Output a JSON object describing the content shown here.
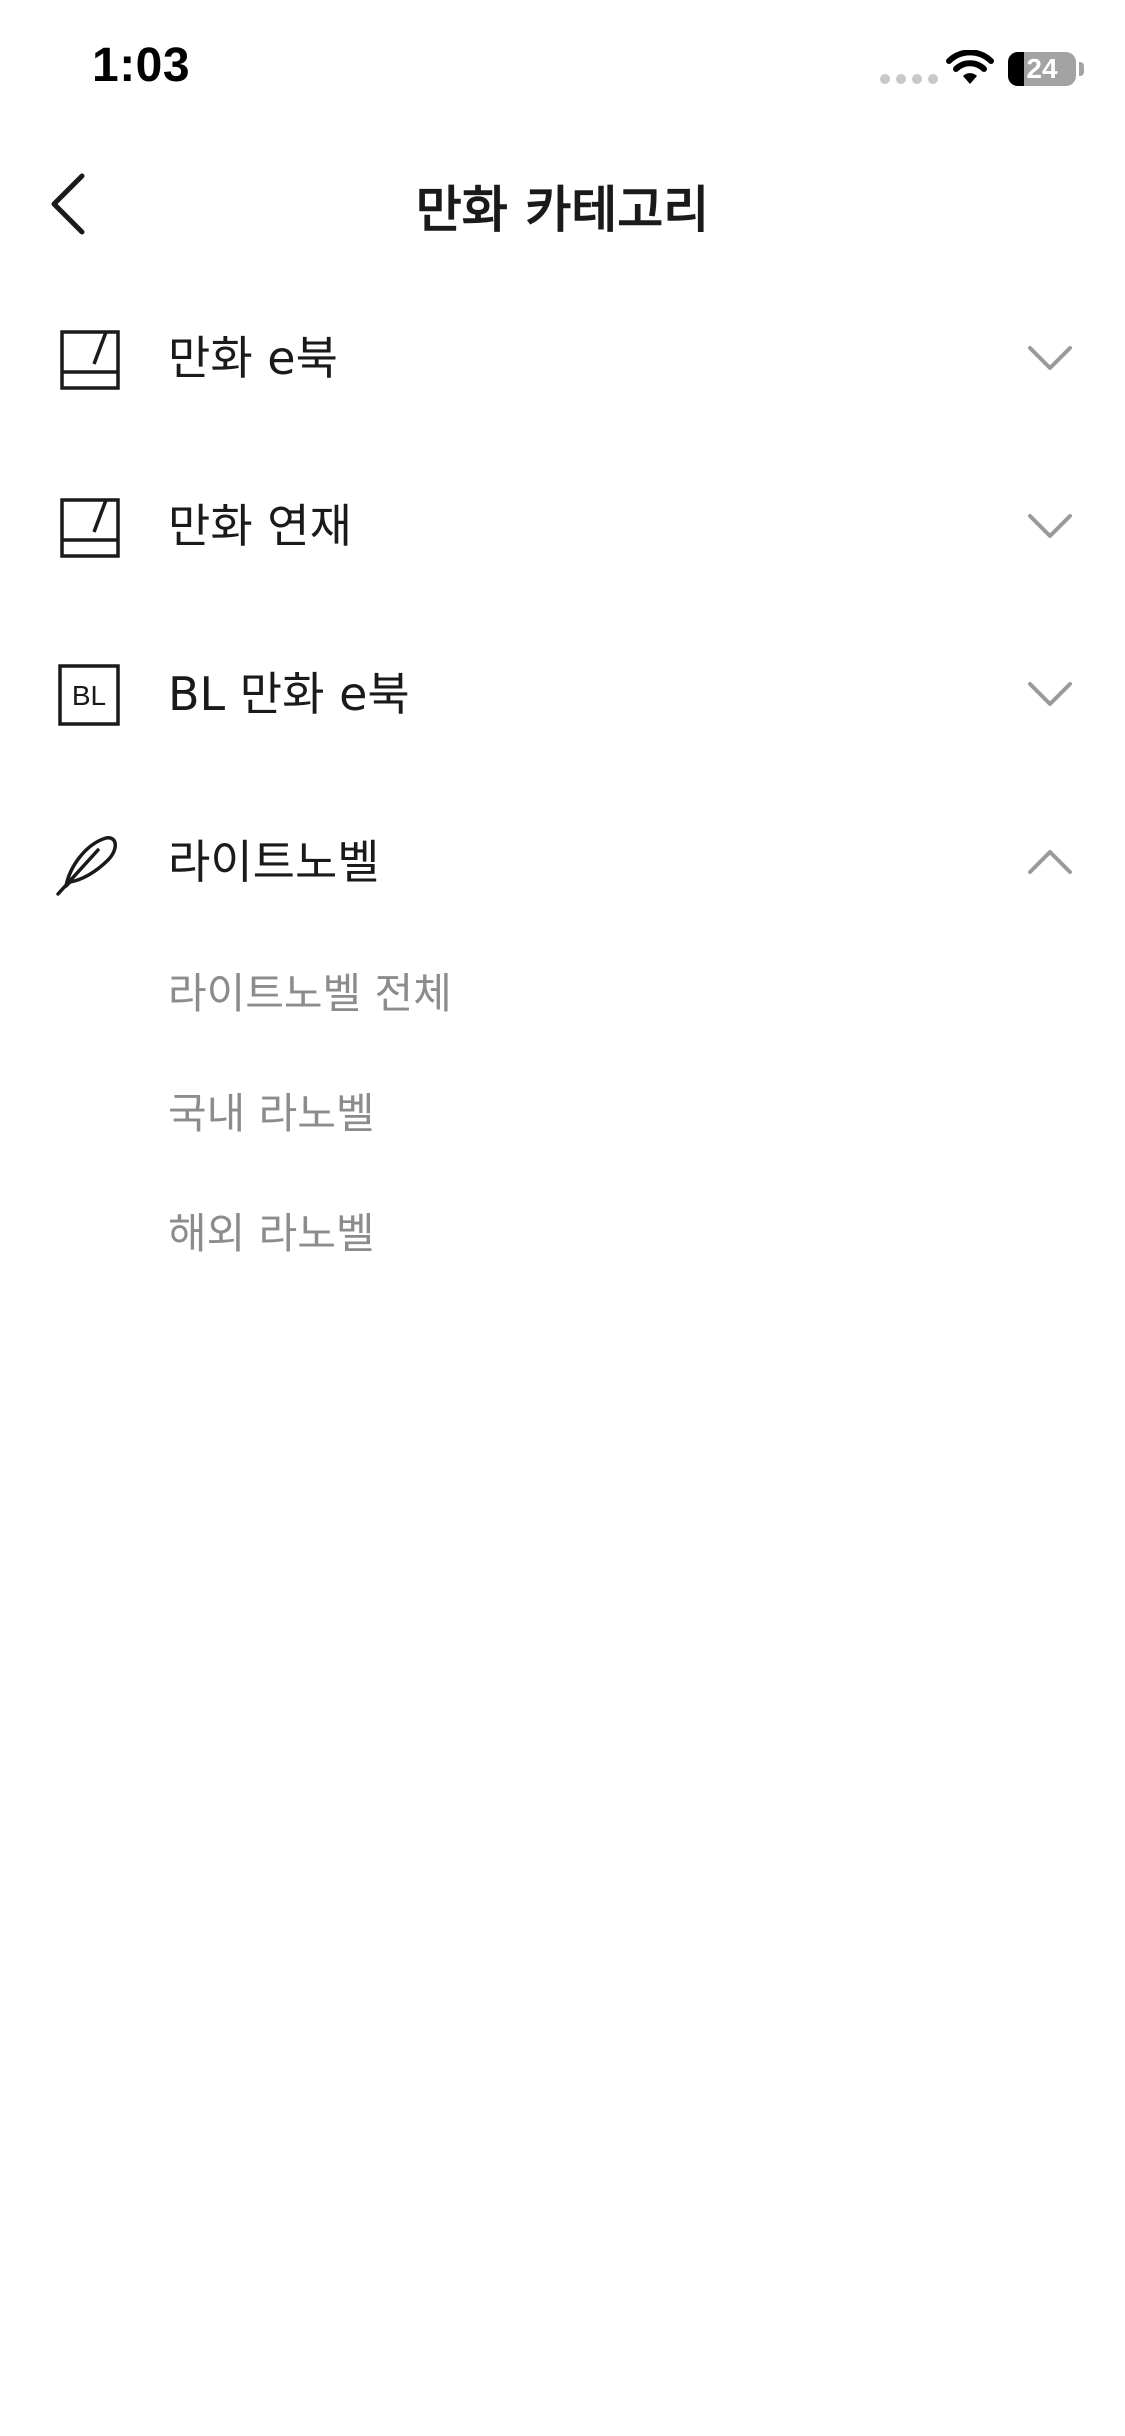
{
  "status_bar": {
    "time": "1:03",
    "battery_level": "24",
    "battery_percent": 24
  },
  "header": {
    "title": "만화 카테고리"
  },
  "categories": [
    {
      "label": "만화 e북",
      "icon": "comic-book-icon",
      "expanded": false
    },
    {
      "label": "만화 연재",
      "icon": "comic-series-icon",
      "expanded": false
    },
    {
      "label": "BL 만화 e북",
      "icon": "bl-badge-icon",
      "icon_text": "BL",
      "expanded": false
    },
    {
      "label": "라이트노벨",
      "icon": "feather-icon",
      "expanded": true,
      "sub_items": [
        "라이트노벨 전체",
        "국내 라노벨",
        "해외 라노벨"
      ]
    }
  ],
  "colors": {
    "text_primary": "#1a1a1a",
    "text_secondary": "#8c8c8c",
    "chevron": "#9a9a9a",
    "background": "#ffffff"
  }
}
